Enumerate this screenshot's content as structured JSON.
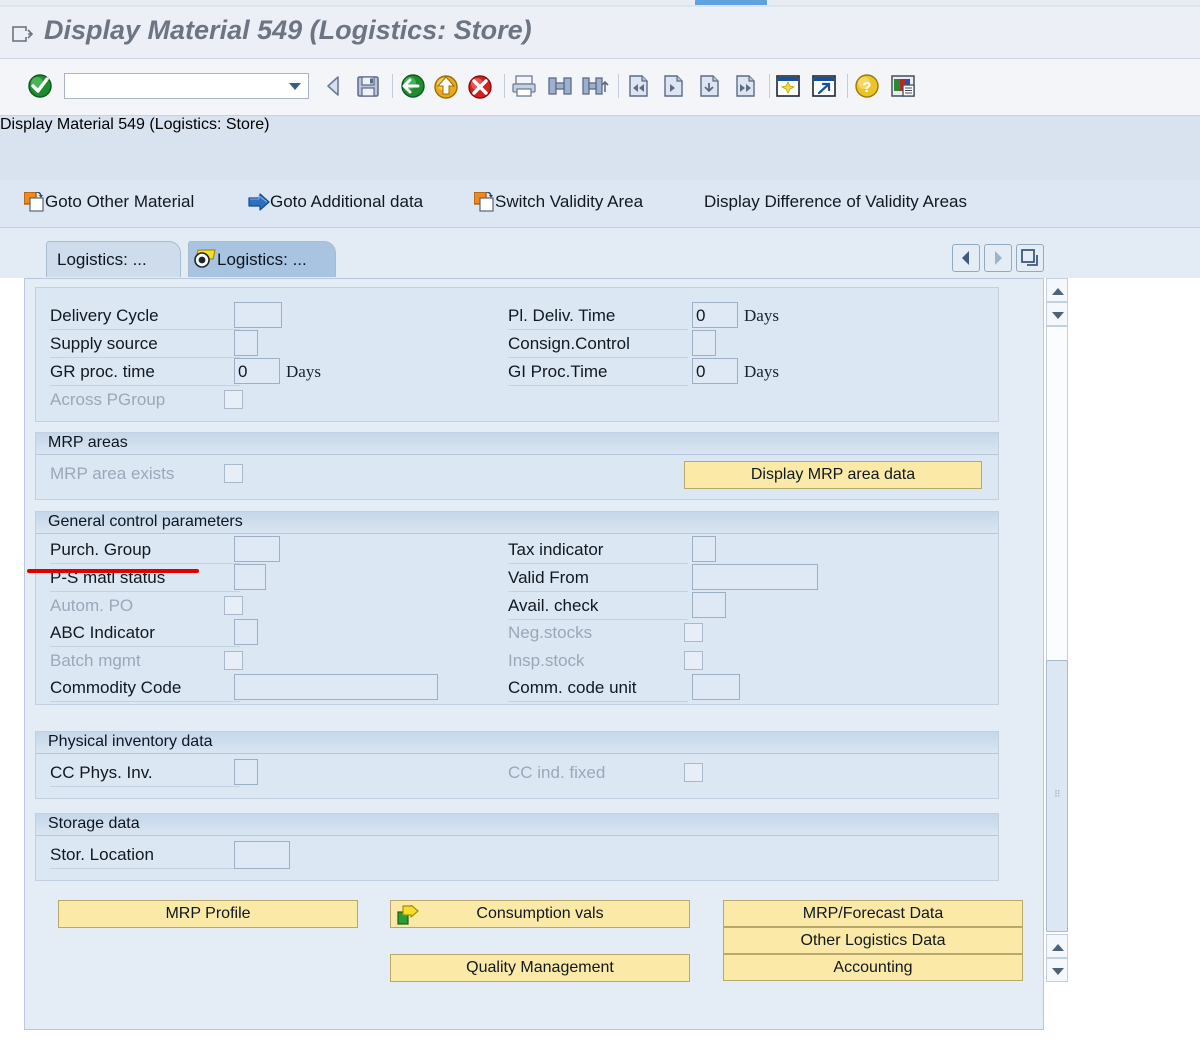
{
  "window": {
    "title": "Display Material 549 (Logistics: Store)",
    "icon": "exit-arrow-icon"
  },
  "toolbar": {
    "command_field_value": "",
    "command_field_placeholder": "",
    "icons": [
      {
        "name": "enter-check-icon",
        "title": "Enter"
      },
      {
        "name": "back-arrow-icon",
        "title": "Back"
      },
      {
        "name": "save-icon",
        "title": "Save"
      },
      {
        "name": "exit-green-icon",
        "title": "Exit"
      },
      {
        "name": "cancel-yellow-icon",
        "title": "Cancel"
      },
      {
        "name": "stop-red-icon",
        "title": "Stop"
      },
      {
        "name": "print-icon",
        "title": "Print"
      },
      {
        "name": "find-icon",
        "title": "Find"
      },
      {
        "name": "find-next-icon",
        "title": "Find Next"
      },
      {
        "name": "first-page-icon",
        "title": "First Page"
      },
      {
        "name": "previous-page-icon",
        "title": "Previous Page"
      },
      {
        "name": "next-page-icon",
        "title": "Next Page"
      },
      {
        "name": "last-page-icon",
        "title": "Last Page"
      },
      {
        "name": "create-session-icon",
        "title": "Create Session"
      },
      {
        "name": "create-shortcut-icon",
        "title": "Create Shortcut"
      },
      {
        "name": "help-icon",
        "title": "Help"
      },
      {
        "name": "customize-layout-icon",
        "title": "Customize Local Layout"
      }
    ]
  },
  "app_header": {
    "title": "Display Material 549 (Logistics: Store)",
    "icon": "material-master-icon"
  },
  "function_bar": {
    "items": [
      {
        "label": "Goto Other Material",
        "icon": "copy-orange-icon"
      },
      {
        "label": "Goto Additional data",
        "icon": "blue-arrow-right-icon"
      },
      {
        "label": "Switch Validity Area",
        "icon": "copy-orange-icon"
      },
      {
        "label": "Display Difference of Validity Areas",
        "icon": "none"
      }
    ]
  },
  "tabs": {
    "items": [
      {
        "label": "Logistics: ...",
        "active": false,
        "icon": "none"
      },
      {
        "label": "Logistics: ...",
        "active": true,
        "icon": "yellow-tab-icon"
      }
    ],
    "nav": [
      {
        "name": "tab-scroll-left",
        "glyph": "◀"
      },
      {
        "name": "tab-scroll-right",
        "glyph": "▶"
      },
      {
        "name": "tab-list",
        "glyph": "❐"
      }
    ]
  },
  "sections": {
    "delivery": {
      "title": "",
      "fields": [
        {
          "label": "Delivery Cycle",
          "value": "",
          "unit": "",
          "type": "input",
          "disabled": false
        },
        {
          "label": "Supply source",
          "value": "",
          "unit": "",
          "type": "input",
          "disabled": false
        },
        {
          "label": "GR proc. time",
          "value": "0",
          "unit": "Days",
          "type": "input",
          "disabled": false
        },
        {
          "label": "Across PGroup",
          "value": "",
          "unit": "",
          "type": "checkbox",
          "disabled": true
        },
        {
          "label": "Pl. Deliv. Time",
          "value": "0",
          "unit": "Days",
          "type": "input",
          "disabled": false
        },
        {
          "label": "Consign.Control",
          "value": "",
          "unit": "",
          "type": "input",
          "disabled": false
        },
        {
          "label": "GI Proc.Time",
          "value": "0",
          "unit": "Days",
          "type": "input",
          "disabled": false
        }
      ]
    },
    "mrp_areas": {
      "title": "MRP areas",
      "fields": [
        {
          "label": "MRP area exists",
          "value": "",
          "unit": "",
          "type": "checkbox",
          "disabled": true
        }
      ],
      "button": "Display MRP area data"
    },
    "general_control": {
      "title": "General control parameters",
      "fields": [
        {
          "label": "Purch. Group",
          "value": "",
          "unit": "",
          "type": "input",
          "disabled": false
        },
        {
          "label": "P-S matl status",
          "value": "",
          "unit": "",
          "type": "input",
          "disabled": false
        },
        {
          "label": "Autom. PO",
          "value": "",
          "unit": "",
          "type": "checkbox",
          "disabled": true
        },
        {
          "label": "ABC Indicator",
          "value": "",
          "unit": "",
          "type": "input",
          "disabled": false
        },
        {
          "label": "Batch mgmt",
          "value": "",
          "unit": "",
          "type": "checkbox",
          "disabled": true
        },
        {
          "label": "Commodity Code",
          "value": "",
          "unit": "",
          "type": "input",
          "disabled": false
        },
        {
          "label": "Tax indicator",
          "value": "",
          "unit": "",
          "type": "input",
          "disabled": false
        },
        {
          "label": "Valid From",
          "value": "",
          "unit": "",
          "type": "input",
          "disabled": false
        },
        {
          "label": "Avail. check",
          "value": "",
          "unit": "",
          "type": "input",
          "disabled": false
        },
        {
          "label": "Neg.stocks",
          "value": "",
          "unit": "",
          "type": "checkbox",
          "disabled": true
        },
        {
          "label": "Insp.stock",
          "value": "",
          "unit": "",
          "type": "checkbox",
          "disabled": true
        },
        {
          "label": "Comm. code unit",
          "value": "",
          "unit": "",
          "type": "input",
          "disabled": false
        }
      ]
    },
    "physical_inventory": {
      "title": "Physical inventory data",
      "fields": [
        {
          "label": "CC Phys. Inv.",
          "value": "",
          "unit": "",
          "type": "input",
          "disabled": false
        },
        {
          "label": "CC ind. fixed",
          "value": "",
          "unit": "",
          "type": "checkbox",
          "disabled": true
        }
      ]
    },
    "storage": {
      "title": "Storage data",
      "fields": [
        {
          "label": "Stor. Location",
          "value": "",
          "unit": "",
          "type": "input",
          "disabled": false
        }
      ]
    }
  },
  "bottom_buttons": {
    "left": [
      {
        "label": "MRP Profile",
        "icon": "none"
      }
    ],
    "middle": [
      {
        "label": "Consumption vals",
        "icon": "green-arrow-icon"
      },
      {
        "label": "Quality Management",
        "icon": "none"
      }
    ],
    "right": [
      {
        "label": "MRP/Forecast Data",
        "icon": "none"
      },
      {
        "label": "Other Logistics Data",
        "icon": "none"
      },
      {
        "label": "Accounting",
        "icon": "none"
      }
    ]
  },
  "annotation": {
    "type": "red-underline",
    "target": "Purch. Group",
    "color": "#e00000"
  },
  "scrollbar": {
    "position": "right",
    "thumb_label": "grip"
  },
  "colors": {
    "accent": "#5fa2dd",
    "panel": "#dbe7f3",
    "content_bg": "#e4ecf6",
    "button": "#fbe9a8",
    "annotation": "#e00000"
  }
}
